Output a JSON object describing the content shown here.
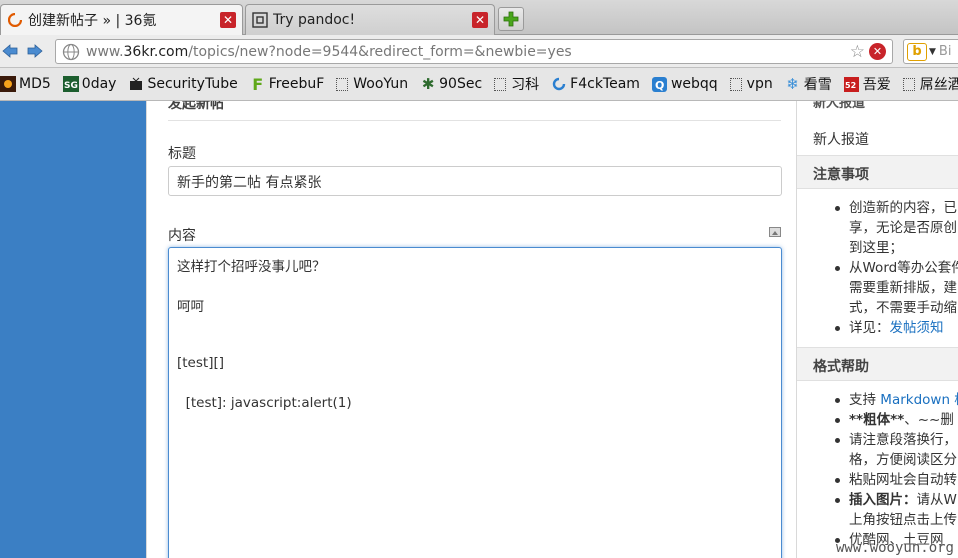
{
  "tabs": [
    {
      "title": "创建新帖子 » | 36氪",
      "favicon": "36kr-loading-icon"
    },
    {
      "title": "Try pandoc!",
      "favicon": "pandoc-icon"
    }
  ],
  "nav": {
    "url_prefix": "www.",
    "url_host": "36kr.com",
    "url_rest": "/topics/new?node=9544&redirect_form=&newbie=yes",
    "search_placeholder": "Bi"
  },
  "bookmarks": [
    {
      "label": "MD5",
      "icon": "md5-icon"
    },
    {
      "label": "0day",
      "icon": "0day-icon"
    },
    {
      "label": "SecurityTube",
      "icon": "securitytube-icon"
    },
    {
      "label": "FreebuF",
      "icon": "freebuf-icon"
    },
    {
      "label": "WooYun",
      "icon": "blank-page-icon"
    },
    {
      "label": "90Sec",
      "icon": "90sec-icon"
    },
    {
      "label": "习科",
      "icon": "blank-page-icon"
    },
    {
      "label": "F4ckTeam",
      "icon": "f4ckteam-icon"
    },
    {
      "label": "webqq",
      "icon": "webqq-icon"
    },
    {
      "label": "vpn",
      "icon": "blank-page-icon"
    },
    {
      "label": "看雪",
      "icon": "kanxue-icon"
    },
    {
      "label": "吾爱",
      "icon": "52pojie-icon"
    },
    {
      "label": "屌丝酒吧",
      "icon": "blank-page-icon"
    }
  ],
  "form": {
    "section_heading": "发起新帖",
    "title_label": "标题",
    "title_value": "新手的第二帖 有点紧张",
    "content_label": "内容",
    "content_lines": [
      "这样打个招呼没事儿吧？",
      "",
      "呵呵",
      "",
      "",
      "[test][]",
      "",
      "  [test]: javascript:alert(1)"
    ]
  },
  "sidebar": {
    "cut_heading": "新人报道",
    "newbie_link": "新人报道",
    "notice_heading": "注意事项",
    "notice_items": [
      [
        "创造新的内容，已",
        "享，无论是否原创",
        "到这里；"
      ],
      [
        "从Word等办公套件",
        "需要重新排版，建",
        "式，不需要手动缩"
      ],
      [
        "详见：",
        "发帖须知"
      ]
    ],
    "format_heading": "格式帮助",
    "format_items": [
      [
        "支持 ",
        "Markdown 格"
      ],
      [
        "**粗体**",
        "、~~删"
      ],
      [
        "请注意段落换行，",
        "格，方便阅读区分"
      ],
      [
        "粘贴网址会自动转"
      ],
      [
        "插入图片：",
        "请从W",
        "上角按钮点击上传"
      ],
      [
        "优酷网、土豆网"
      ]
    ]
  },
  "watermark": "www.wooyun.org"
}
